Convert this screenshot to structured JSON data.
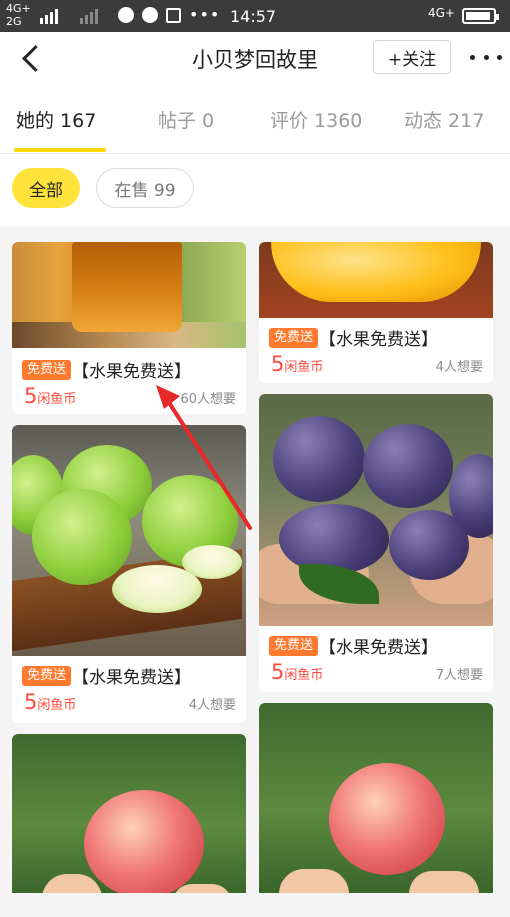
{
  "status_bar": {
    "network_top": "4G+",
    "network_bottom": "2G",
    "time": "14:57",
    "network_right": "4G+"
  },
  "header": {
    "title": "小贝梦回故里",
    "follow_label": "+关注"
  },
  "tabs": [
    {
      "label": "她的 167"
    },
    {
      "label": "帖子 0"
    },
    {
      "label": "评价 1360"
    },
    {
      "label": "动态 217"
    }
  ],
  "filters": [
    {
      "label": "全部"
    },
    {
      "label": "在售 99"
    }
  ],
  "items": [
    {
      "badge": "免费送",
      "title": "【水果免费送】",
      "price": "5",
      "currency": "闲鱼币",
      "wants": "60人想要",
      "image": "honey-jar"
    },
    {
      "badge": "免费送",
      "title": "【水果免费送】",
      "price": "5",
      "currency": "闲鱼币",
      "wants": "4人想要",
      "image": "yellow-plum"
    },
    {
      "badge": "免费送",
      "title": "【水果免费送】",
      "price": "5",
      "currency": "闲鱼币",
      "wants": "4人想要",
      "image": "green-apples"
    },
    {
      "badge": "免费送",
      "title": "【水果免费送】",
      "price": "5",
      "currency": "闲鱼币",
      "wants": "7人想要",
      "image": "purple-plums"
    },
    {
      "image": "peach"
    },
    {
      "image": "peach"
    }
  ],
  "colors": {
    "accent": "#ffd600",
    "badge": "#ff7a2e",
    "price": "#ff4a3d",
    "annotation_arrow": "#e8282b"
  }
}
